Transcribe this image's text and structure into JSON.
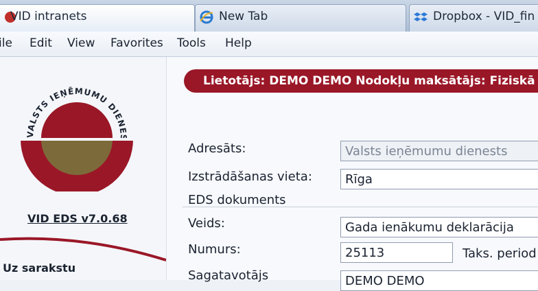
{
  "tabs": [
    {
      "label": "VID intranets",
      "icon": "ie-icon"
    },
    {
      "label": "New Tab",
      "icon": "ie-icon"
    },
    {
      "label": "Dropbox - VID_fin",
      "icon": "dropbox-icon"
    }
  ],
  "menu": [
    "ile",
    "Edit",
    "View",
    "Favorites",
    "Tools",
    "Help"
  ],
  "logo": {
    "text": "VALSTS IEŅĒMUMU DIENESTS"
  },
  "version": "VID EDS v7.0.68",
  "left_link": "Uz sarakstu",
  "user_bar": "Lietotājs: DEMO DEMO Nodokļu maksātājs: Fiziskā",
  "form": {
    "adresats_label": "Adresāts:",
    "adresats_value": "Valsts ieņēmumu dienests",
    "vieta_label": "Izstrādāšanas vieta:",
    "vieta_value": "Rīga",
    "section": "EDS dokuments",
    "veids_label": "Veids:",
    "veids_value": "Gada ienākumu deklarācija",
    "numurs_label": "Numurs:",
    "numurs_value": "25113",
    "taks_label": "Taks. period",
    "sagat_label": "Sagatavotājs",
    "sagat_value": "DEMO DEMO"
  },
  "colors": {
    "accent": "#9a1727",
    "logo_gold": "#7d6a3a"
  }
}
